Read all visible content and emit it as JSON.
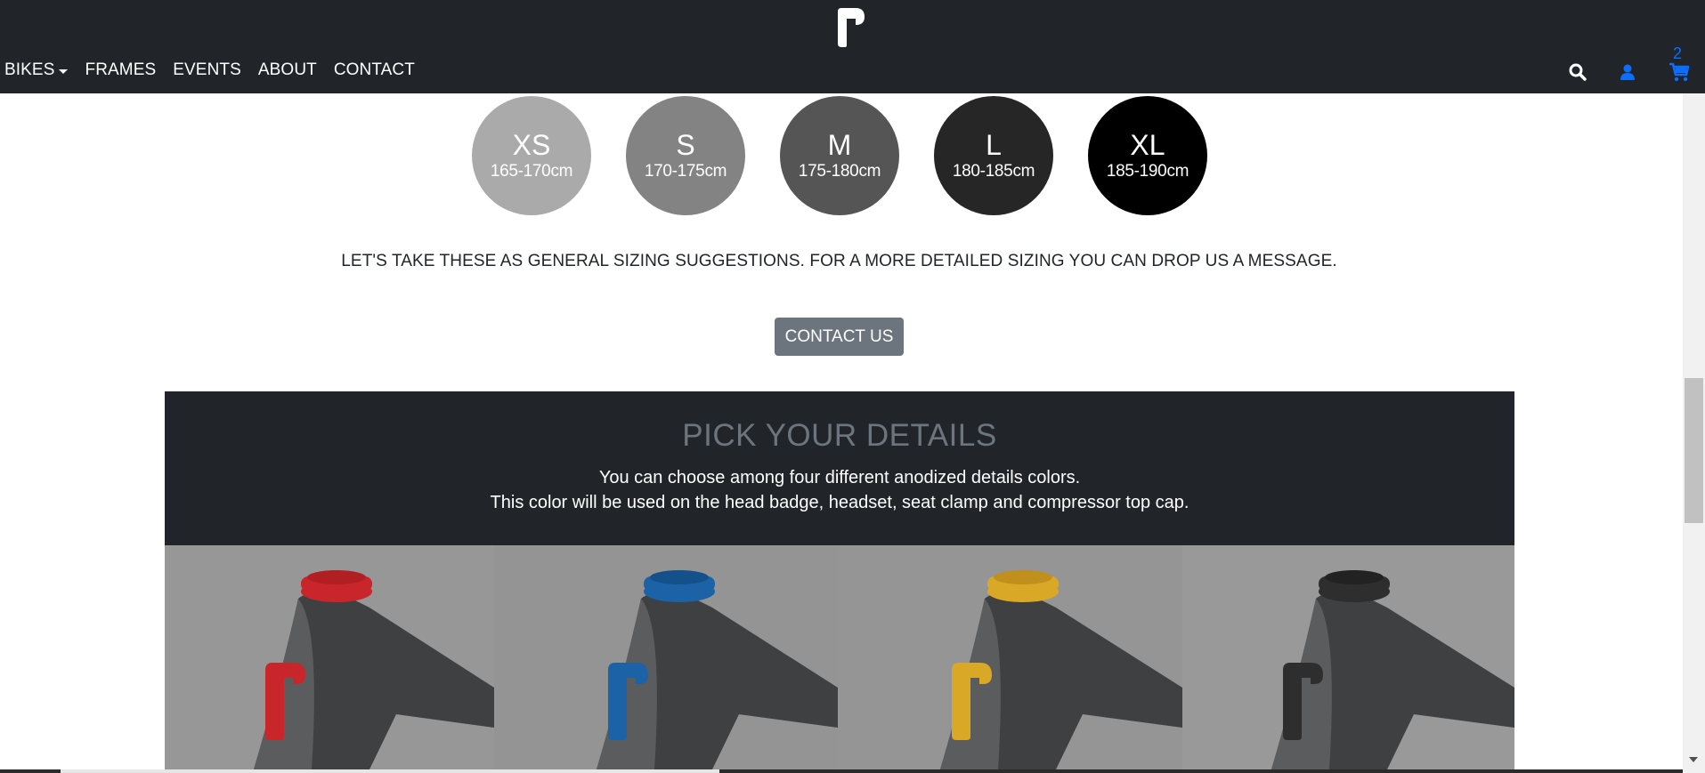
{
  "nav": {
    "items": [
      {
        "label": "BIKES",
        "dropdown": true
      },
      {
        "label": "FRAMES"
      },
      {
        "label": "EVENTS"
      },
      {
        "label": "ABOUT"
      },
      {
        "label": "CONTACT"
      }
    ],
    "icons": [
      "search-icon",
      "user-icon",
      "cart-icon"
    ],
    "cart_count": "2",
    "accent_color": "#0d6efd"
  },
  "sizes": [
    {
      "label": "XS",
      "range": "165-170cm",
      "color": "#aaaaaa"
    },
    {
      "label": "S",
      "range": "170-175cm",
      "color": "#838383"
    },
    {
      "label": "M",
      "range": "175-180cm",
      "color": "#555555"
    },
    {
      "label": "L",
      "range": "180-185cm",
      "color": "#262626"
    },
    {
      "label": "XL",
      "range": "185-190cm",
      "color": "#000000"
    }
  ],
  "sizing_note": "LET'S TAKE THESE AS GENERAL SIZING SUGGESTIONS. FOR A MORE DETAILED SIZING YOU CAN DROP US A MESSAGE.",
  "contact_button": "CONTACT US",
  "details": {
    "title": "PICK YOUR DETAILS",
    "line1": "You can choose among four different anodized details colors.",
    "line2": "This color will be used on the head badge, headset, seat clamp and compressor top cap.",
    "colors": [
      {
        "name": "red",
        "hex": "#c8262a"
      },
      {
        "name": "blue",
        "hex": "#1b63a6"
      },
      {
        "name": "yellow",
        "hex": "#d9a826"
      },
      {
        "name": "black",
        "hex": "#2e2e2e"
      }
    ]
  }
}
